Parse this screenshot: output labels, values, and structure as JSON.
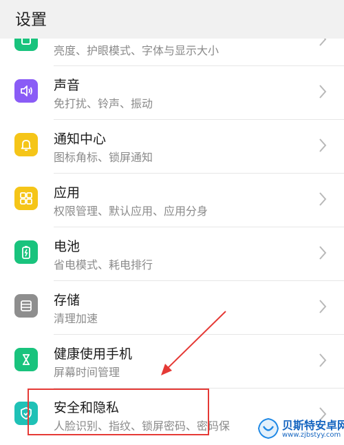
{
  "header": {
    "title": "设置"
  },
  "items": [
    {
      "title": "",
      "subtitle": "亮度、护眼模式、字体与显示大小",
      "icon": "display-icon",
      "color": "#19c37d"
    },
    {
      "title": "声音",
      "subtitle": "免打扰、铃声、振动",
      "icon": "speaker-icon",
      "color": "#8a5cf6"
    },
    {
      "title": "通知中心",
      "subtitle": "图标角标、锁屏通知",
      "icon": "bell-icon",
      "color": "#f5c518"
    },
    {
      "title": "应用",
      "subtitle": "权限管理、默认应用、应用分身",
      "icon": "apps-grid-icon",
      "color": "#f5c518"
    },
    {
      "title": "电池",
      "subtitle": "省电模式、耗电排行",
      "icon": "battery-icon",
      "color": "#19c37d"
    },
    {
      "title": "存储",
      "subtitle": "清理加速",
      "icon": "storage-icon",
      "color": "#8e8e8e"
    },
    {
      "title": "健康使用手机",
      "subtitle": "屏幕时间管理",
      "icon": "hourglass-icon",
      "color": "#19c37d"
    },
    {
      "title": "安全和隐私",
      "subtitle": "人脸识别、指纹、锁屏密码、密码保",
      "icon": "shield-icon",
      "color": "#1fc1b6"
    }
  ],
  "watermark": {
    "name": "贝斯特安卓网",
    "url": "www.zjbstyy.com"
  },
  "annotation_color": "#e53935"
}
